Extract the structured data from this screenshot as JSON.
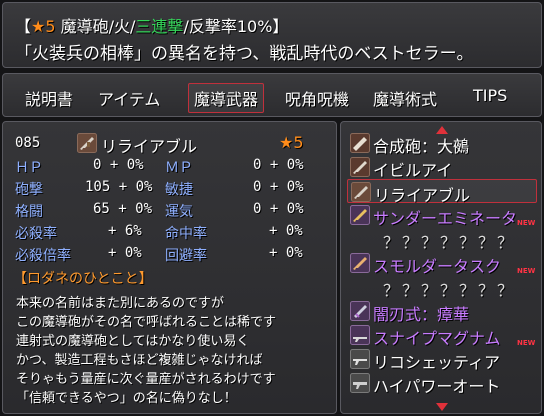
{
  "header": {
    "line1_prefix": "【",
    "star": "★5",
    "line1_part_a": " 魔導砲/火/",
    "line1_highlight": "三連撃",
    "line1_part_b": "/反撃率10%】",
    "description": "「火装兵の相棒」の異名を持つ、戦乱時代のベストセラー。"
  },
  "tabs": [
    "説明書",
    "アイテム",
    "魔導武器",
    "呪角呪機",
    "魔導術式",
    "TIPS"
  ],
  "active_tab": "魔導武器",
  "weapon": {
    "number": "085",
    "name": "リライアブル",
    "rarity": "★5",
    "icon": "gun-icon"
  },
  "stats": [
    {
      "label": "ＨＰ",
      "value": "0 + 0%",
      "color": "blue"
    },
    {
      "label": "ＭＰ",
      "value": "0 + 0%",
      "color": "blue"
    },
    {
      "label": "砲撃",
      "value": "105 + 0%",
      "color": "blue"
    },
    {
      "label": "敏捷",
      "value": "0 + 0%",
      "color": "blue"
    },
    {
      "label": "格闘",
      "value": "65 + 0%",
      "color": "blue"
    },
    {
      "label": "運気",
      "value": "0 + 0%",
      "color": "blue"
    },
    {
      "label": "必殺率",
      "value": "+ 6%",
      "color": "blue"
    },
    {
      "label": "命中率",
      "value": "+ 0%",
      "color": "blue"
    },
    {
      "label": "必殺倍率",
      "value": "+ 0%",
      "color": "blue"
    },
    {
      "label": "回避率",
      "value": "+ 0%",
      "color": "blue"
    }
  ],
  "hint": {
    "title": "【ロダネのひとこと】",
    "lines": [
      "本来の名前はまた別にあるのですが",
      "この魔導砲がその名で呼ばれることは稀です",
      "連射式の魔導砲としてはかなり使い易く",
      "かつ、製造工程もさほど複雑じゃなければ",
      "そりゃもう量産に次ぐ量産がされるわけです",
      "「信頼できるやつ」の名に偽りなし！"
    ]
  },
  "items": [
    {
      "name": "合成砲：大鵺",
      "style": "normal",
      "is_new": false,
      "icon": "cannon-icon"
    },
    {
      "name": "イビルアイ",
      "style": "normal",
      "is_new": false,
      "icon": "gun-icon"
    },
    {
      "name": "リライアブル",
      "style": "normal",
      "is_new": false,
      "icon": "gun-icon",
      "selected": true
    },
    {
      "name": "サンダーエミネータ",
      "style": "purple",
      "is_new": true,
      "icon": "gun-icon"
    },
    {
      "name": "？？？？？？？",
      "style": "unknown",
      "is_new": false,
      "icon": ""
    },
    {
      "name": "スモルダータスク",
      "style": "purple",
      "is_new": true,
      "icon": "gun-icon"
    },
    {
      "name": "？？？？？？？",
      "style": "unknown",
      "is_new": false,
      "icon": ""
    },
    {
      "name": "闇刃式：瘴華",
      "style": "purple",
      "is_new": false,
      "icon": "blade-gun-icon"
    },
    {
      "name": "スナイプマグナム",
      "style": "purple",
      "is_new": true,
      "icon": "gun-icon"
    },
    {
      "name": "リコシェッティア",
      "style": "normal",
      "is_new": false,
      "icon": "gun-icon"
    },
    {
      "name": "ハイパワーオート",
      "style": "normal",
      "is_new": false,
      "icon": "gun-icon"
    }
  ],
  "new_badge": "NEW",
  "colors": {
    "accent_orange": "#ff8c1a",
    "skill_green": "#35d65a",
    "label_blue": "#8fb0ff",
    "rare_purple": "#c87cff",
    "selection_red": "#c0303c"
  }
}
